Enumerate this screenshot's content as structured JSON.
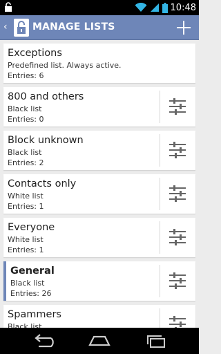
{
  "status_bar": {
    "time": "10:48"
  },
  "action_bar": {
    "title": "MANAGE LISTS",
    "up_glyph": "‹"
  },
  "lists": [
    {
      "name": "Exceptions",
      "type": "Predefined list. Always active.",
      "entries": "Entries: 6",
      "selected": false,
      "has_settings": false
    },
    {
      "name": "800 and others",
      "type": "Black list",
      "entries": "Entries: 0",
      "selected": false,
      "has_settings": true
    },
    {
      "name": "Block unknown",
      "type": "Black list",
      "entries": "Entries: 2",
      "selected": false,
      "has_settings": true
    },
    {
      "name": "Contacts only",
      "type": "White list",
      "entries": "Entries: 1",
      "selected": false,
      "has_settings": true
    },
    {
      "name": "Everyone",
      "type": "White list",
      "entries": "Entries: 1",
      "selected": false,
      "has_settings": true
    },
    {
      "name": "General",
      "type": "Black list",
      "entries": "Entries: 26",
      "selected": true,
      "has_settings": true
    },
    {
      "name": "Spammers",
      "type": "Black list",
      "entries": "",
      "selected": false,
      "has_settings": true
    }
  ],
  "colors": {
    "action_bar": "#6e86b8",
    "selected_accent": "#6e86b8",
    "background": "#ececec"
  },
  "icons": {
    "notification": "lock-notification-icon",
    "app": "padlock-app-icon",
    "add": "plus-icon",
    "settings": "sliders-icon",
    "back": "back-icon",
    "home": "home-icon",
    "recents": "recents-icon"
  }
}
